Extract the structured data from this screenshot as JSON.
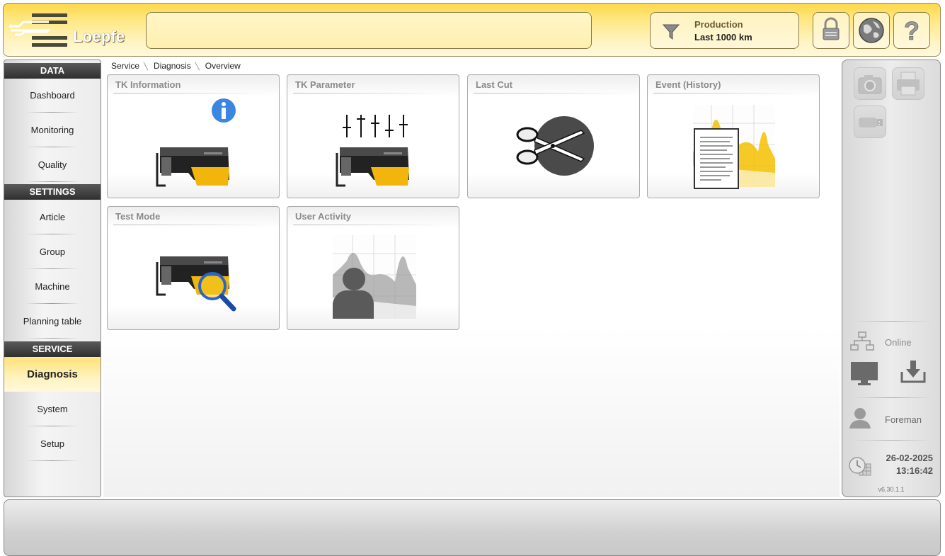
{
  "header": {
    "logo_text": "Loepfe",
    "filter": {
      "title": "Production",
      "value": "Last 1000 km"
    }
  },
  "sidebar": {
    "sections": [
      {
        "heading": "DATA",
        "items": [
          "Dashboard",
          "Monitoring",
          "Quality"
        ]
      },
      {
        "heading": "SETTINGS",
        "items": [
          "Article",
          "Group",
          "Machine",
          "Planning table"
        ]
      },
      {
        "heading": "SERVICE",
        "items": [
          "Diagnosis",
          "System",
          "Setup"
        ]
      }
    ],
    "active_item": "Diagnosis"
  },
  "breadcrumb": [
    "Service",
    "Diagnosis",
    "Overview"
  ],
  "tiles": [
    {
      "title": "TK Information",
      "icon": "tk-information-icon"
    },
    {
      "title": "TK Parameter",
      "icon": "tk-parameter-icon"
    },
    {
      "title": "Last Cut",
      "icon": "scissors-icon"
    },
    {
      "title": "Event (History)",
      "icon": "event-history-icon"
    },
    {
      "title": "Test Mode",
      "icon": "test-mode-icon"
    },
    {
      "title": "User Activity",
      "icon": "user-activity-icon"
    }
  ],
  "right_panel": {
    "connection_status": "Online",
    "user_role": "Foreman",
    "date": "26-02-2025",
    "time": "13:16:42",
    "version": "v6.30.1.1"
  },
  "colors": {
    "accent": "#ffd84a",
    "active_nav": "#ffe27a",
    "section_header": "#3a3a3a"
  }
}
